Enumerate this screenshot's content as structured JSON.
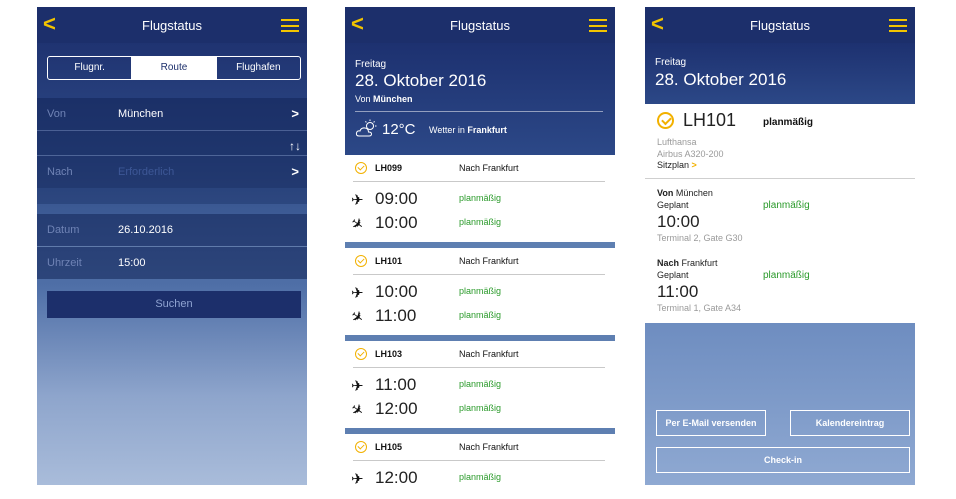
{
  "screens": {
    "search": {
      "nav": {
        "back": "<",
        "title": "Flugstatus"
      },
      "tabs": [
        "Flugnr.",
        "Route",
        "Flughafen"
      ],
      "from": {
        "label": "Von",
        "value": "München",
        "chevron": ">"
      },
      "swap": "↑↓",
      "to": {
        "label": "Nach",
        "placeholder": "Erforderlich",
        "chevron": ">"
      },
      "date": {
        "label": "Datum",
        "value": "26.10.2016"
      },
      "time": {
        "label": "Uhrzeit",
        "value": "15:00"
      },
      "search_button": "Suchen"
    },
    "results": {
      "nav": {
        "back": "<",
        "title": "Flugstatus"
      },
      "day": "Freitag",
      "date": "28. Oktober 2016",
      "from_prefix": "Von",
      "from_city": "München",
      "temperature": "12°C",
      "weather_prefix": "Wetter in",
      "weather_city": "Frankfurt",
      "flights": [
        {
          "number": "LH099",
          "destination": "Nach Frankfurt",
          "departure": "09:00",
          "departure_status": "planmäßig",
          "arrival": "10:00",
          "arrival_status": "planmäßig"
        },
        {
          "number": "LH101",
          "destination": "Nach Frankfurt",
          "departure": "10:00",
          "departure_status": "planmäßig",
          "arrival": "11:00",
          "arrival_status": "planmäßig"
        },
        {
          "number": "LH103",
          "destination": "Nach Frankfurt",
          "departure": "11:00",
          "departure_status": "planmäßig",
          "arrival": "12:00",
          "arrival_status": "planmäßig"
        },
        {
          "number": "LH105",
          "destination": "Nach Frankfurt",
          "departure": "12:00",
          "departure_status": "planmäßig"
        }
      ]
    },
    "detail": {
      "nav": {
        "back": "<",
        "title": "Flugstatus"
      },
      "day": "Freitag",
      "date": "28. Oktober 2016",
      "flight_number": "LH101",
      "status": "planmäßig",
      "airline": "Lufthansa",
      "aircraft": "Airbus A320-200",
      "seatmap": "Sitzplan",
      "seatmap_arrow": ">",
      "departure": {
        "prefix": "Von",
        "city": "München",
        "planned_label": "Geplant",
        "status": "planmäßig",
        "time": "10:00",
        "terminal": "Terminal 2, Gate G30"
      },
      "arrival": {
        "prefix": "Nach",
        "city": "Frankfurt",
        "planned_label": "Geplant",
        "status": "planmäßig",
        "time": "11:00",
        "terminal": "Terminal 1, Gate A34"
      },
      "email_button": "Per E-Mail versenden",
      "calendar_button": "Kalendereintrag",
      "checkin_button": "Check-in"
    }
  },
  "colors": {
    "navy": "#1c2f6b",
    "accent_yellow": "#f2c400",
    "status_green": "#2a9a2a"
  },
  "icons": {
    "back": "chevron-left-icon",
    "menu": "hamburger-menu-icon",
    "logo": "lufthansa-crane-icon",
    "takeoff": "takeoff-icon",
    "landing": "landing-icon",
    "weather": "partly-cloudy-icon"
  }
}
